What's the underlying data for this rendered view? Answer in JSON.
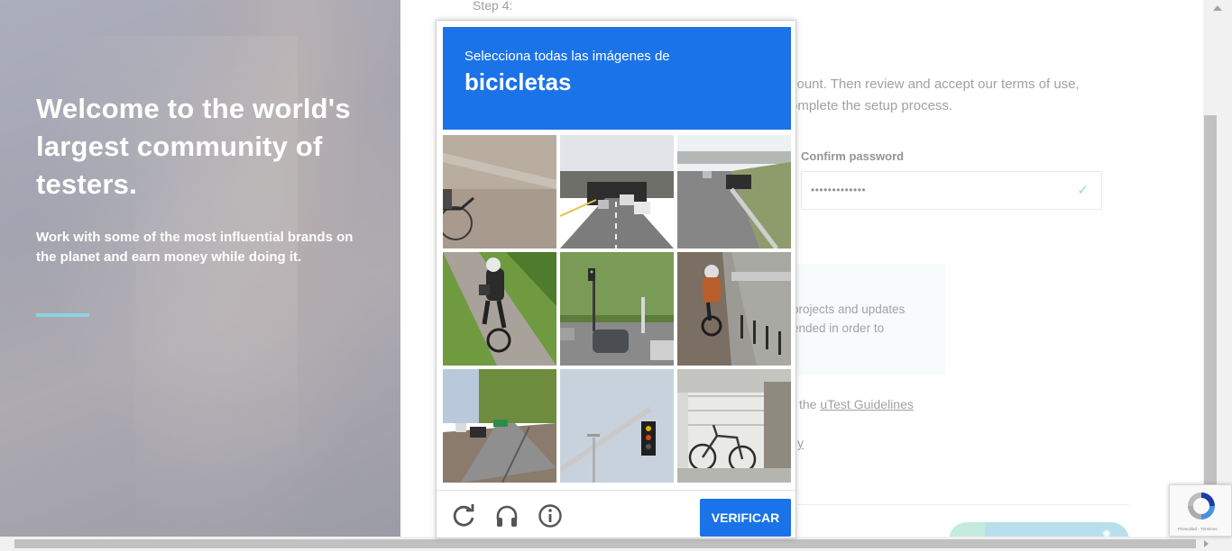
{
  "hero": {
    "title": "Welcome to the world's largest community of testers.",
    "subtitle": "Work with some of the most influential brands on the planet and earn money while doing it."
  },
  "form": {
    "step_label": "Step 4:",
    "intro_text": "count. Then review and accept our terms of use, omplete the setup process.",
    "confirm_password_label": "Confirm password",
    "confirm_password_value": "•••••••••••••",
    "info_line1": "projects and updates",
    "info_line2": "ended in order to",
    "guidelines_prefix": "the ",
    "guidelines_link": "uTest Guidelines",
    "policy_fragment": "y"
  },
  "captcha": {
    "instruction": "Selecciona todas las imágenes de",
    "target": "bicicletas",
    "verify_label": "VERIFICAR",
    "tiles": [
      {
        "scene": "dirt road with bicycle wheel"
      },
      {
        "scene": "highway tunnel with cars"
      },
      {
        "scene": "highway with cars and bridge"
      },
      {
        "scene": "cyclist on grass path"
      },
      {
        "scene": "street with traffic light and car"
      },
      {
        "scene": "cyclist on bike lane"
      },
      {
        "scene": "tree-lined street with cars"
      },
      {
        "scene": "traffic light pole against sky"
      },
      {
        "scene": "parked bicycle by fence"
      }
    ]
  },
  "recaptcha_badge": {
    "links": "Privacidad - Términos"
  },
  "colors": {
    "captcha_blue": "#1a73e8",
    "hero_accent": "#6fc8d6",
    "check_green": "#7dd0b4"
  }
}
